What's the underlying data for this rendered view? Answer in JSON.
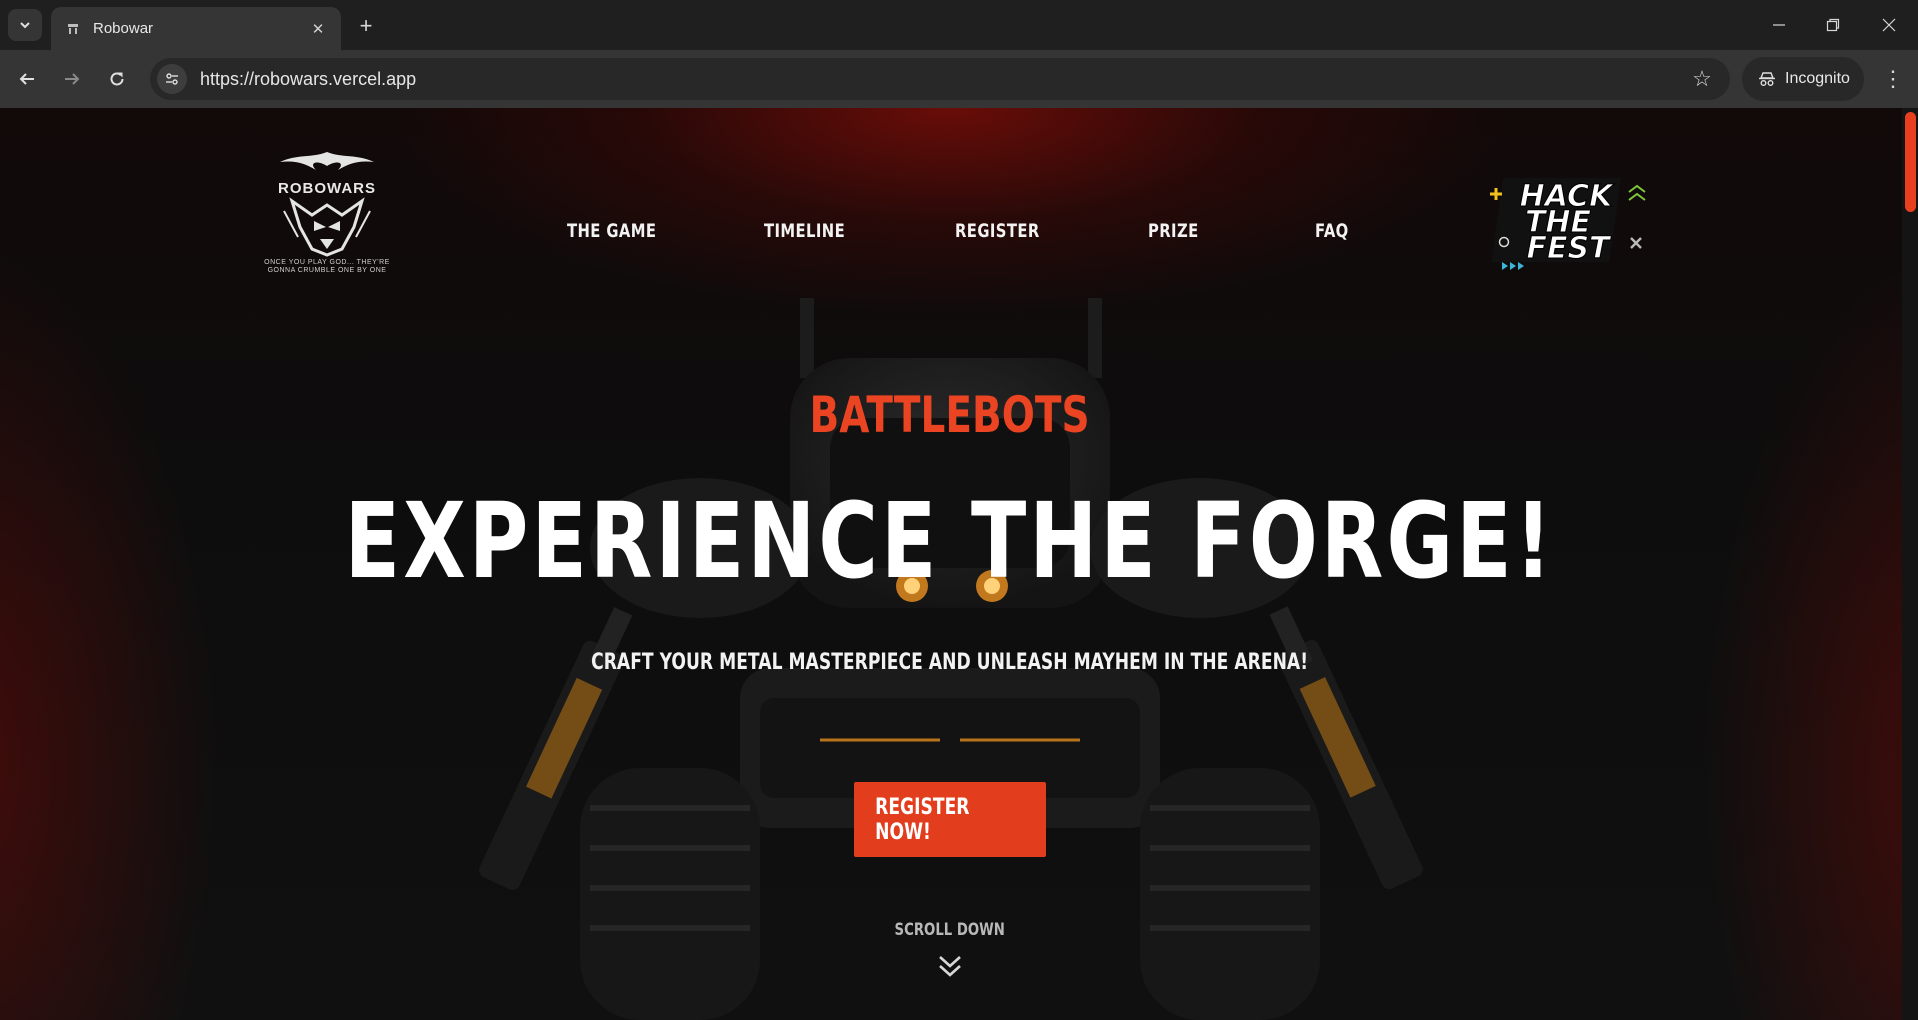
{
  "browser": {
    "tab_title": "Robowar",
    "url": "https://robowars.vercel.app",
    "profile_label": "Incognito"
  },
  "site": {
    "logo": {
      "wordmark": "ROBOWARS",
      "tagline": "ONCE YOU PLAY GOD... THEY'RE GONNA CRUMBLE ONE BY ONE"
    },
    "nav": [
      "THE GAME",
      "TIMELINE",
      "REGISTER",
      "PRIZE",
      "FAQ"
    ],
    "partner_logo": {
      "lines": [
        "HACK",
        "THE",
        "FEST"
      ]
    }
  },
  "hero": {
    "kicker": "BATTLEBOTS",
    "headline": "EXPERIENCE THE FORGE!",
    "subheadline": "CRAFT YOUR METAL MASTERPIECE AND UNLEASH MAYHEM IN THE ARENA!",
    "cta_label": "REGISTER NOW!",
    "scroll_label": "SCROLL DOWN"
  },
  "colors": {
    "accent": "#e23e1d",
    "kicker": "#ea4422",
    "scrollbar_thumb": "#e8401f"
  }
}
